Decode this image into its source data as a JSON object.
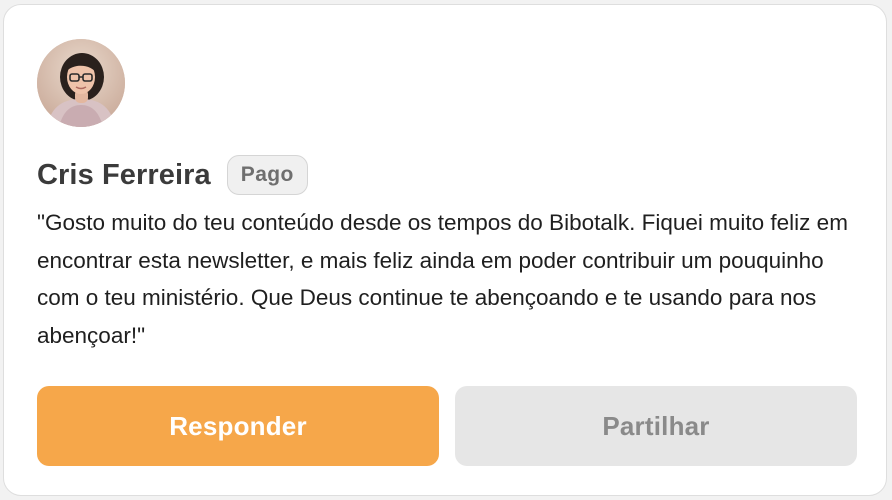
{
  "comment_card": {
    "author": {
      "name": "Cris Ferreira",
      "badge": "Pago",
      "avatar": "author-avatar-photo"
    },
    "text": "\"Gosto muito do teu conteúdo desde os tempos do Bibotalk. Fiquei muito feliz em encontrar esta newsletter, e mais feliz ainda em poder contribuir um pouquinho com o teu ministério. Que Deus continue te abençoando e te usando para nos abençoar!\"",
    "actions": {
      "reply_label": "Responder",
      "share_label": "Partilhar"
    }
  },
  "colors": {
    "accent": "#f6a74a",
    "secondary_button": "#e6e6e6",
    "secondary_text": "#8a8a8a",
    "badge_bg": "#f0f0f0"
  }
}
